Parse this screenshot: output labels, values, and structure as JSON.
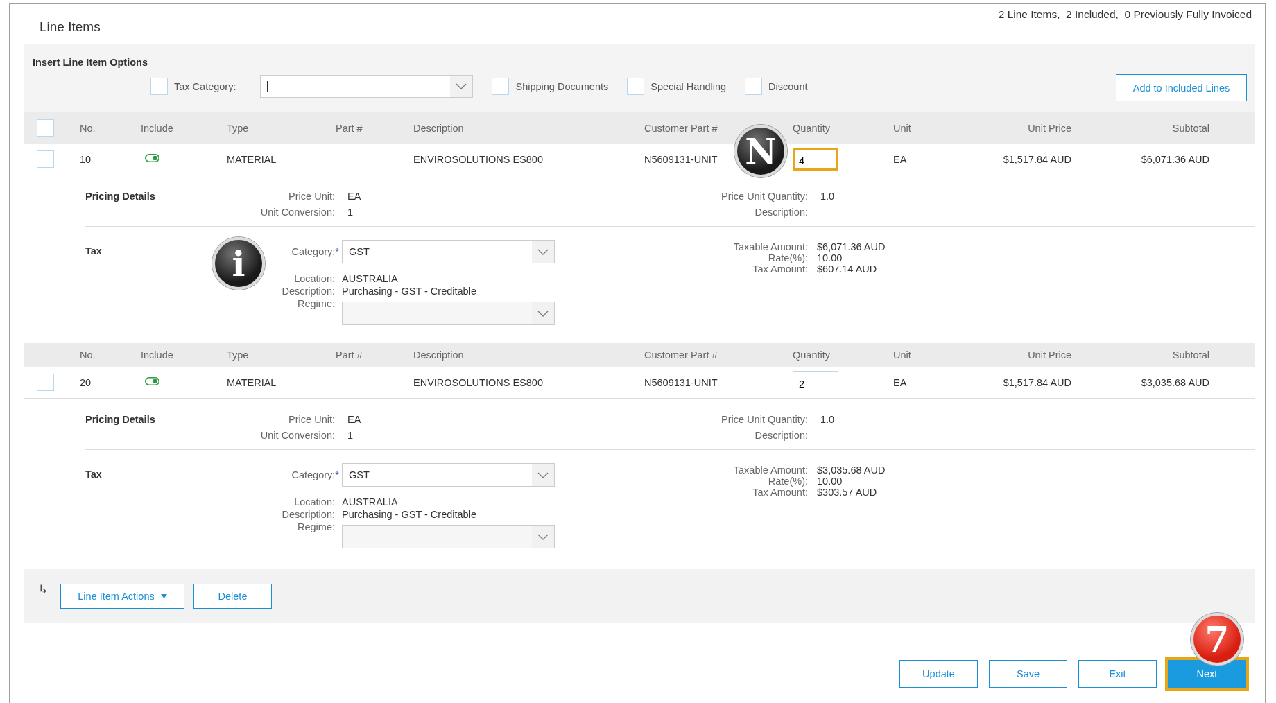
{
  "header": {
    "title": "Line Items",
    "summary": "2 Line Items,  2 Included,  0 Previously Fully Invoiced"
  },
  "insert_options": {
    "title": "Insert Line Item Options",
    "tax_category": {
      "label": "Tax Category:",
      "checked": false
    },
    "options": [
      {
        "label": "Shipping Documents",
        "checked": false
      },
      {
        "label": "Special Handling",
        "checked": false
      },
      {
        "label": "Discount",
        "checked": false
      }
    ],
    "add_button": "Add to Included Lines"
  },
  "line_items": [
    {
      "select_all": {
        "checked": false
      },
      "columns": [
        "No.",
        "Include",
        "Type",
        "Part #",
        "Description",
        "Customer Part #",
        "Quantity",
        "Unit",
        "Unit Price",
        "Subtotal"
      ],
      "selected": false,
      "no": "10",
      "include": true,
      "type": "MATERIAL",
      "description": "ENVIROSOLUTIONS ES800",
      "customer_part": "N5609131-UNIT",
      "quantity": "4",
      "quantity_highlighted": true,
      "unit": "EA",
      "unit_price": "$1,517.84 AUD",
      "subtotal": "$6,071.36 AUD",
      "pricing": {
        "title": "Pricing Details",
        "fields": [
          {
            "label": "Price Unit:",
            "value": "EA"
          },
          {
            "label": "Unit Conversion:",
            "value": "1"
          }
        ],
        "fields_right": [
          {
            "label": "Price Unit Quantity:",
            "value": "1.0"
          },
          {
            "label": "Description:"
          }
        ]
      },
      "tax": {
        "title": "Tax",
        "category_label": "Category:",
        "required_mark": "*",
        "category": "GST",
        "location_label": "Location:",
        "location": "AUSTRALIA",
        "description_label": "Description:",
        "description": "Purchasing - GST - Creditable",
        "regime_label": "Regime:",
        "amounts": [
          {
            "label": "Taxable Amount:",
            "value": "$6,071.36 AUD"
          },
          {
            "label": "Rate(%):",
            "value": "10.00"
          },
          {
            "label": "Tax Amount:",
            "value": "$607.14 AUD"
          }
        ]
      }
    },
    {
      "columns": [
        "No.",
        "Include",
        "Type",
        "Part #",
        "Description",
        "Customer Part #",
        "Quantity",
        "Unit",
        "Unit Price",
        "Subtotal"
      ],
      "selected": false,
      "no": "20",
      "include": true,
      "type": "MATERIAL",
      "description": "ENVIROSOLUTIONS ES800",
      "customer_part": "N5609131-UNIT",
      "quantity": "2",
      "quantity_highlighted": false,
      "unit": "EA",
      "unit_price": "$1,517.84 AUD",
      "subtotal": "$3,035.68 AUD",
      "pricing": {
        "title": "Pricing Details",
        "fields": [
          {
            "label": "Price Unit:",
            "value": "EA"
          },
          {
            "label": "Unit Conversion:",
            "value": "1"
          }
        ],
        "fields_right": [
          {
            "label": "Price Unit Quantity:",
            "value": "1.0"
          },
          {
            "label": "Description:"
          }
        ]
      },
      "tax": {
        "title": "Tax",
        "category_label": "Category:",
        "required_mark": "*",
        "category": "GST",
        "location_label": "Location:",
        "location": "AUSTRALIA",
        "description_label": "Description:",
        "description": "Purchasing - GST - Creditable",
        "regime_label": "Regime:",
        "amounts": [
          {
            "label": "Taxable Amount:",
            "value": "$3,035.68 AUD"
          },
          {
            "label": "Rate(%):",
            "value": "10.00"
          },
          {
            "label": "Tax Amount:",
            "value": "$303.57 AUD"
          }
        ]
      }
    }
  ],
  "actions_bar": {
    "arrow": "↳",
    "buttons": [
      {
        "label": "Line Item Actions",
        "kind": "menu"
      },
      {
        "label": "Delete",
        "kind": "plain"
      }
    ]
  },
  "footer_buttons": [
    {
      "label": "Update",
      "primary": false,
      "highlighted": false
    },
    {
      "label": "Save",
      "primary": false,
      "highlighted": false
    },
    {
      "label": "Exit",
      "primary": false,
      "highlighted": false
    },
    {
      "label": "Next",
      "primary": true,
      "highlighted": true
    }
  ],
  "callouts": [
    {
      "text": "N",
      "color": "#1a1a1a"
    },
    {
      "text": "i",
      "color": "#1a1a1a"
    },
    {
      "text": "7",
      "color": "#d81e10"
    }
  ]
}
